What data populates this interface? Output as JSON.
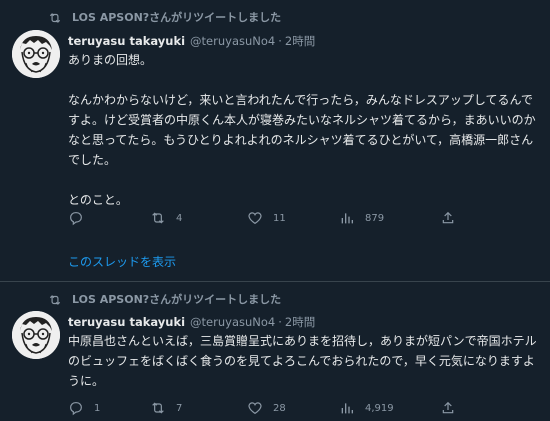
{
  "tweets": [
    {
      "retweet_label": "LOS APSON?さんがリツイートしました",
      "author_name": "teruyasu takayuki",
      "author_handle": "@teruyasuNo4",
      "separator": "·",
      "time": "2時間",
      "text": "ありまの回想。\n\nなんかわからないけど，来いと言われたんで行ったら，みんなドレスアップしてるんですよ。けど受賞者の中原くん本人が寝巻みたいなネルシャツ着てるから，まあいいのかなと思ってたら。もうひとりよれよれのネルシャツ着てるひとがいて，高橋源一郎さんでした。\n\nとのこと。",
      "reply_count": "",
      "retweet_count": "4",
      "like_count": "11",
      "view_count": "879",
      "thread_link": "このスレッドを表示"
    },
    {
      "retweet_label": "LOS APSON?さんがリツイートしました",
      "author_name": "teruyasu takayuki",
      "author_handle": "@teruyasuNo4",
      "separator": "·",
      "time": "2時間",
      "text": "中原昌也さんといえば，三島賞贈呈式にありまを招待し，ありまが短パンで帝国ホテルのビュッフェをばくばく食うのを見てよろこんでおられたので，早く元気になりますように。",
      "reply_count": "1",
      "retweet_count": "7",
      "like_count": "28",
      "view_count": "4,919"
    }
  ],
  "colors": {
    "background": "#15202b",
    "text": "#e7e9ea",
    "muted": "#8b98a5",
    "link": "#1d9bf0",
    "divider": "#38444d"
  },
  "icons": [
    "retweet-icon",
    "reply-icon",
    "like-icon",
    "views-icon",
    "share-icon"
  ]
}
